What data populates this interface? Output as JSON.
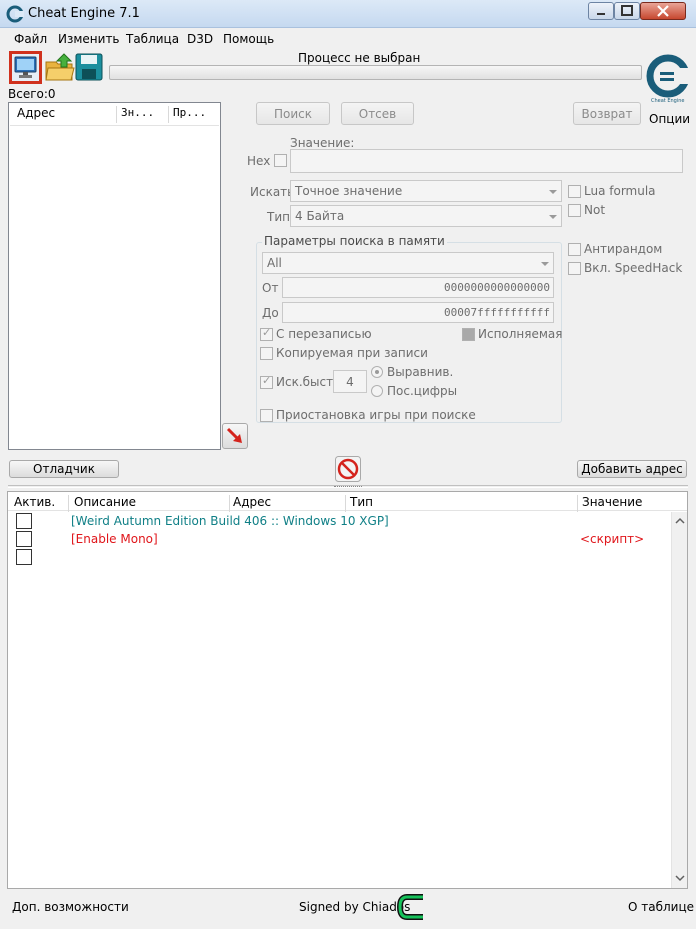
{
  "window": {
    "title": "Cheat Engine 7.1"
  },
  "menu": [
    "Файл",
    "Изменить",
    "Таблица",
    "D3D",
    "Помощь"
  ],
  "process": {
    "label": "Процесс не выбран"
  },
  "found": {
    "label": "Всего:0"
  },
  "logo": {
    "options_label": "Опции",
    "logo_text": "Cheat Engine"
  },
  "address_list": {
    "headers": [
      "Адрес",
      "Зн...",
      "Пр..."
    ]
  },
  "scan": {
    "first_scan": "Поиск",
    "next_scan": "Отсев",
    "undo_scan": "Возврат",
    "value_label": "Значение:",
    "hex_label": "Hex",
    "scan_type_label": "Искать",
    "scan_type_value": "Точное значение",
    "value_type_label": "Тип",
    "value_type_value": "4 Байта",
    "lua_formula": "Lua formula",
    "not_label": "Not",
    "mem_group_title": "Параметры поиска в памяти",
    "region_value": "All",
    "from_label": "От",
    "from_value": "0000000000000000",
    "to_label": "До",
    "to_value": "00007fffffffffff",
    "writable": "С перезаписью",
    "executable": "Исполняемая",
    "copy_on_write": "Копируемая при записи",
    "fast_scan": "Иск.быст.",
    "fast_scan_value": "4",
    "alignment": "Выравнив.",
    "last_digits": "Пос.цифры",
    "pause_game": "Приостановка игры при поиске",
    "unrandomizer": "Антирандом",
    "speedhack": "Вкл. SpeedHack"
  },
  "middle": {
    "memory_view": "Отладчик",
    "add_address": "Добавить адрес"
  },
  "table": {
    "headers": [
      "Актив.",
      "Описание",
      "Адрес",
      "Тип",
      "Значение"
    ],
    "rows": [
      {
        "description": "[Weird Autumn Edition Build 406 :: Windows 10 XGP]",
        "value": "",
        "color": "#0f7f86"
      },
      {
        "description": "[Enable Mono]",
        "value": "<скрипт>",
        "color": "#e0161b"
      },
      {
        "description": "",
        "value": "",
        "color": "#000000"
      }
    ]
  },
  "status": {
    "advanced": "Доп. возможности",
    "signed": "Signed by Chiados",
    "about": "О таблице"
  }
}
